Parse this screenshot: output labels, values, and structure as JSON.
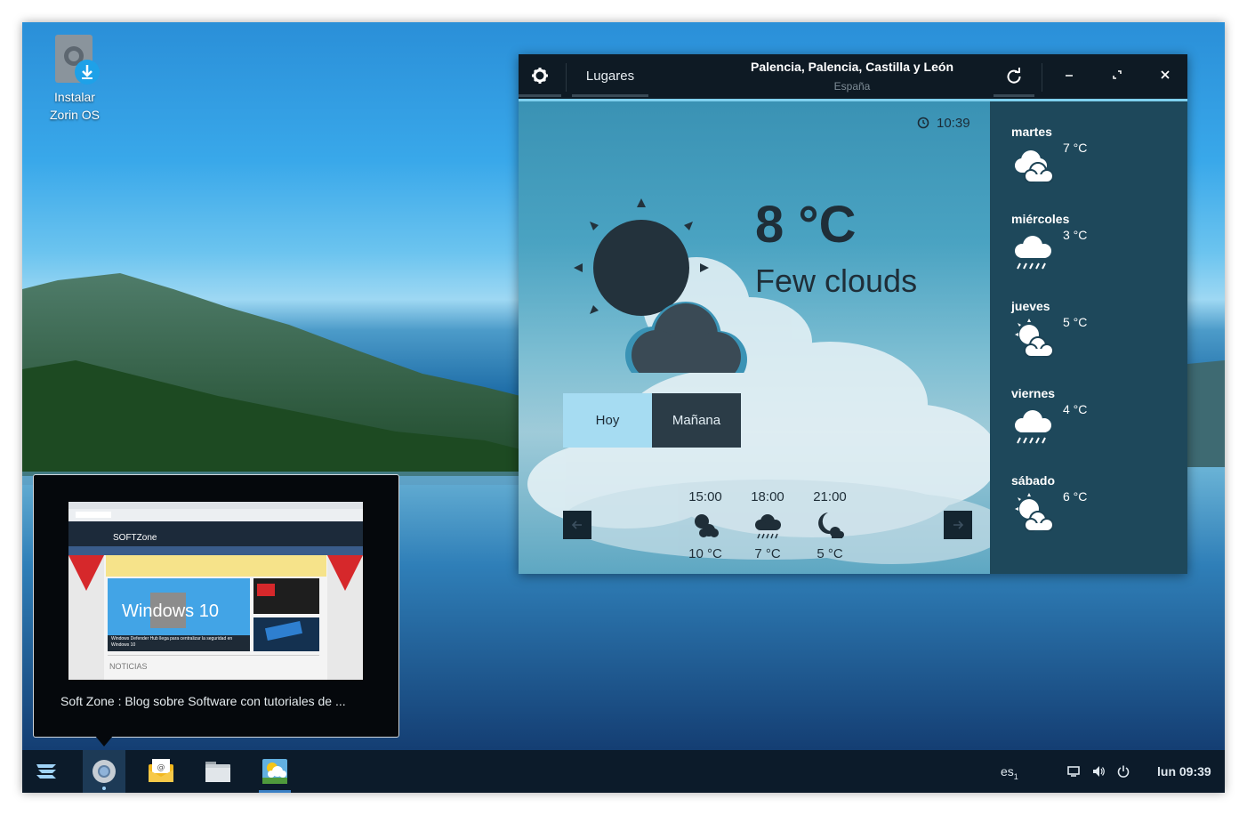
{
  "desktop": {
    "icons": [
      {
        "label_line1": "Instalar",
        "label_line2": "Zorin OS",
        "icon": "install-download-icon"
      }
    ]
  },
  "weather_app": {
    "toolbar": {
      "settings_icon": "gear-icon",
      "places_label": "Lugares",
      "location_title": "Palencia, Palencia, Castilla y León",
      "location_country": "España",
      "refresh_icon": "refresh-icon",
      "minimize_icon": "minimize-icon",
      "maximize_icon": "maximize-icon",
      "close_icon": "close-icon"
    },
    "current": {
      "time": "10:39",
      "temperature": "8 °C",
      "condition": "Few clouds",
      "icon": "few-clouds-icon"
    },
    "tabs": [
      {
        "label": "Hoy",
        "selected": false
      },
      {
        "label": "Mañana",
        "selected": true
      }
    ],
    "hourly": [
      {
        "time": "15:00",
        "temp": "10 °C",
        "icon": "partly-cloudy-icon"
      },
      {
        "time": "18:00",
        "temp": "7 °C",
        "icon": "rain-icon"
      },
      {
        "time": "21:00",
        "temp": "5 °C",
        "icon": "night-cloudy-icon"
      }
    ],
    "nav": {
      "prev_icon": "arrow-left-icon",
      "next_icon": "arrow-right-icon"
    },
    "forecast": [
      {
        "day": "martes",
        "temp": "7 °C",
        "icon": "clouds-icon"
      },
      {
        "day": "miércoles",
        "temp": "3 °C",
        "icon": "rain-icon"
      },
      {
        "day": "jueves",
        "temp": "5 °C",
        "icon": "partly-cloudy-icon"
      },
      {
        "day": "viernes",
        "temp": "4 °C",
        "icon": "rain-icon"
      },
      {
        "day": "sábado",
        "temp": "6 °C",
        "icon": "partly-cloudy-icon"
      }
    ],
    "colors": {
      "accent": "#7fd0ee",
      "header": "#0e1a24",
      "sidebar": "#1c4254"
    }
  },
  "window_preview": {
    "caption": "Soft Zone : Blog sobre Software con tutoriales de ...",
    "thumbnail": {
      "site_logo": "SOFTZone",
      "headline": "Windows Defender Hub llega para centralizar la seguridad en Windows 10",
      "section": "NOTICIAS",
      "banner_text": "Windows 10"
    }
  },
  "taskbar": {
    "items": [
      {
        "name": "zorin-menu",
        "icon": "zorin-logo-icon"
      },
      {
        "name": "chrome",
        "icon": "chrome-icon",
        "active": true
      },
      {
        "name": "mail",
        "icon": "mail-icon"
      },
      {
        "name": "files",
        "icon": "folder-icon"
      },
      {
        "name": "weather",
        "icon": "weather-app-icon"
      }
    ],
    "tray": {
      "language": "es",
      "language_sub": "1",
      "display_icon": "display-icon",
      "volume_icon": "volume-icon",
      "power_icon": "power-icon",
      "clock": "lun 09:39"
    }
  }
}
